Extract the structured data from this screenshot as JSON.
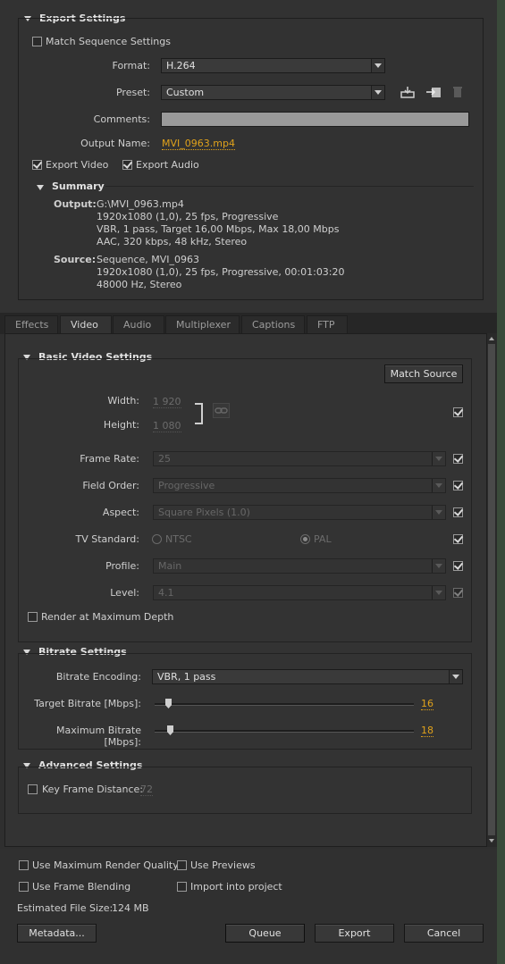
{
  "export": {
    "title": "Export Settings",
    "match_sequence": "Match Sequence Settings",
    "format_label": "Format:",
    "format_value": "H.264",
    "preset_label": "Preset:",
    "preset_value": "Custom",
    "comments_label": "Comments:",
    "comments_value": "",
    "output_name_label": "Output Name:",
    "output_name_value": "MVI_0963.mp4",
    "export_video": "Export Video",
    "export_audio": "Export Audio"
  },
  "summary": {
    "title": "Summary",
    "output_label": "Output:",
    "output_lines": [
      "G:\\MVI_0963.mp4",
      "1920x1080 (1,0), 25 fps, Progressive",
      "VBR, 1 pass, Target 16,00 Mbps, Max 18,00 Mbps",
      "AAC, 320 kbps, 48 kHz, Stereo"
    ],
    "source_label": "Source:",
    "source_lines": [
      "Sequence, MVI_0963",
      "1920x1080 (1,0), 25 fps, Progressive, 00:01:03:20",
      "48000 Hz, Stereo"
    ]
  },
  "tabs": [
    "Effects",
    "Video",
    "Audio",
    "Multiplexer",
    "Captions",
    "FTP"
  ],
  "basic_video": {
    "title": "Basic Video Settings",
    "match_source": "Match Source",
    "width_label": "Width:",
    "width_value": "1 920",
    "height_label": "Height:",
    "height_value": "1 080",
    "frame_rate_label": "Frame Rate:",
    "frame_rate_value": "25",
    "field_order_label": "Field Order:",
    "field_order_value": "Progressive",
    "aspect_label": "Aspect:",
    "aspect_value": "Square Pixels (1.0)",
    "tv_standard_label": "TV Standard:",
    "ntsc": "NTSC",
    "pal": "PAL",
    "profile_label": "Profile:",
    "profile_value": "Main",
    "level_label": "Level:",
    "level_value": "4.1",
    "render_max_depth": "Render at Maximum Depth"
  },
  "bitrate": {
    "title": "Bitrate Settings",
    "encoding_label": "Bitrate Encoding:",
    "encoding_value": "VBR, 1 pass",
    "target_label": "Target Bitrate [Mbps]:",
    "target_value": "16",
    "max_label": "Maximum Bitrate [Mbps]:",
    "max_value": "18"
  },
  "advanced": {
    "title": "Advanced Settings",
    "key_frame_label": "Key Frame Distance:",
    "key_frame_value": "72"
  },
  "footer": {
    "max_render_quality": "Use Maximum Render Quality",
    "use_previews": "Use Previews",
    "frame_blending": "Use Frame Blending",
    "import_project": "Import into project",
    "file_size_label": "Estimated File Size:",
    "file_size_value": "124 MB",
    "metadata_btn": "Metadata...",
    "queue_btn": "Queue",
    "export_btn": "Export",
    "cancel_btn": "Cancel"
  },
  "icons": [
    "save-preset-icon",
    "import-preset-icon",
    "delete-preset-icon",
    "link-icon"
  ],
  "colors": {
    "accent": "#e0a21b",
    "background": "#2f2f2f"
  }
}
